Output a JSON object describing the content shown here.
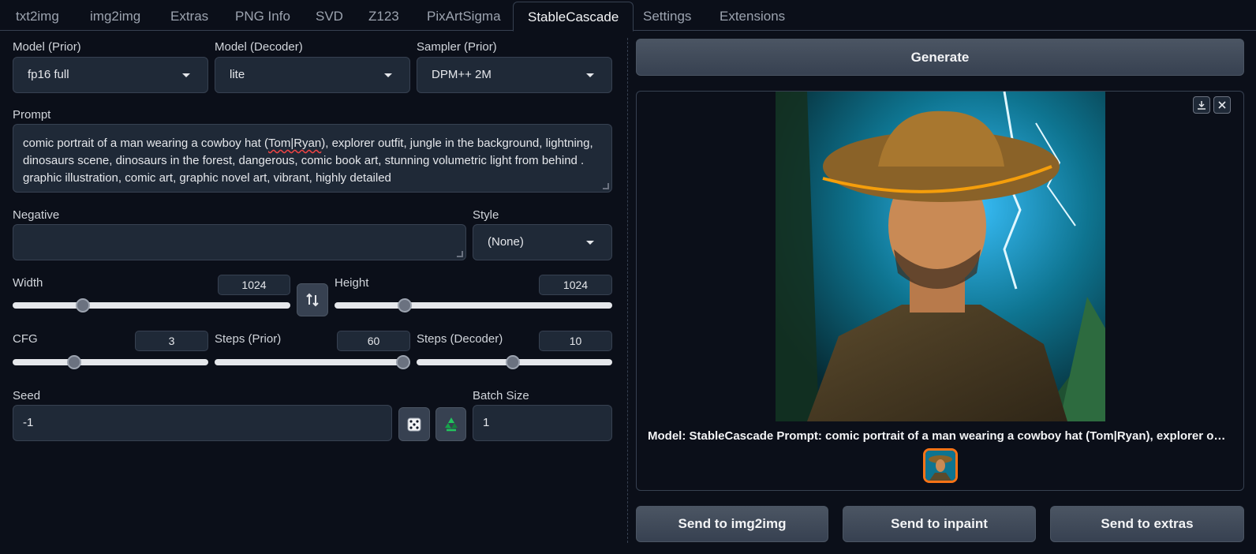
{
  "tabs": [
    {
      "label": "txt2img"
    },
    {
      "label": "img2img"
    },
    {
      "label": "Extras"
    },
    {
      "label": "PNG Info"
    },
    {
      "label": "SVD"
    },
    {
      "label": "Z123"
    },
    {
      "label": "PixArtSigma"
    },
    {
      "label": "StableCascade",
      "active": true
    },
    {
      "label": "Settings"
    },
    {
      "label": "Extensions"
    }
  ],
  "models": {
    "prior_label": "Model (Prior)",
    "prior_value": "fp16 full",
    "decoder_label": "Model (Decoder)",
    "decoder_value": "lite",
    "sampler_label": "Sampler (Prior)",
    "sampler_value": "DPM++ 2M"
  },
  "prompt": {
    "label": "Prompt",
    "text_before": "comic portrait of a man wearing a cowboy hat (",
    "text_marked": "Tom|Ryan",
    "text_after": "), explorer outfit, jungle in the background, lightning, dinosaurs scene, dinosaurs in the forest, dangerous, comic book art, stunning volumetric light from behind . graphic illustration, comic art, graphic novel art, vibrant, highly detailed"
  },
  "negative": {
    "label": "Negative",
    "value": ""
  },
  "style": {
    "label": "Style",
    "value": "(None)"
  },
  "width": {
    "label": "Width",
    "value": "1024",
    "fraction": 0.24
  },
  "height": {
    "label": "Height",
    "value": "1024",
    "fraction": 0.24
  },
  "cfg": {
    "label": "CFG",
    "value": "3",
    "fraction": 0.3
  },
  "steps_prior": {
    "label": "Steps (Prior)",
    "value": "60",
    "fraction": 1.0
  },
  "steps_decoder": {
    "label": "Steps (Decoder)",
    "value": "10",
    "fraction": 0.49
  },
  "seed": {
    "label": "Seed",
    "value": "-1"
  },
  "batch_size": {
    "label": "Batch Size",
    "value": "1"
  },
  "generate_label": "Generate",
  "output": {
    "caption": "Model: StableCascade Prompt: comic portrait of a man wearing a cowboy hat (Tom|Ryan), explorer outfit, ju…"
  },
  "send_buttons": {
    "img2img": "Send to img2img",
    "inpaint": "Send to inpaint",
    "extras": "Send to extras"
  },
  "colors": {
    "background": "#0b0f19",
    "accent_thumb_border": "#f97316",
    "input_bg": "#1f2937"
  }
}
